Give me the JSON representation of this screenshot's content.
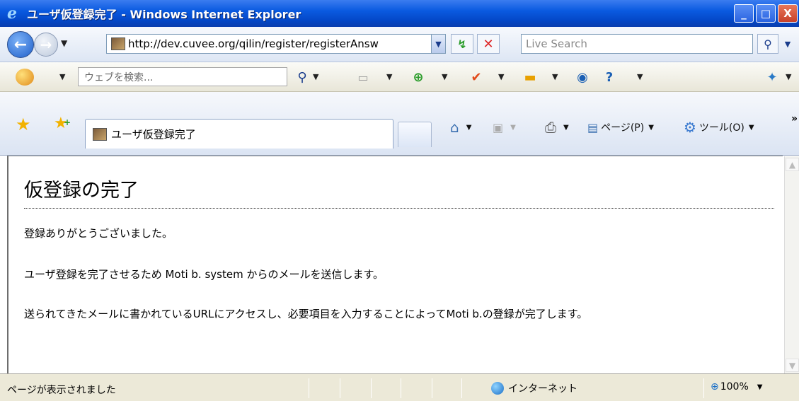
{
  "window": {
    "title": "ユーザ仮登録完了 - Windows Internet Explorer",
    "buttons": {
      "minimize": "_",
      "maximize": "□",
      "close": "X"
    }
  },
  "address_bar": {
    "url": "http://dev.cuvee.org/qilin/register/registerAnsw",
    "search_placeholder": "Live Search"
  },
  "search_toolbar": {
    "placeholder": "ウェブを検索..."
  },
  "tabs": [
    {
      "label": "ユーザ仮登録完了",
      "active": true
    }
  ],
  "command_bar": {
    "page_label": "ページ(P)",
    "tools_label": "ツール(O)"
  },
  "page": {
    "heading": "仮登録の完了",
    "paragraphs": [
      "登録ありがとうございました。",
      "ユーザ登録を完了させるため Moti b. system からのメールを送信します。",
      "送られてきたメールに書かれているURLにアクセスし、必要項目を入力することによってMoti b.の登録が完了します。"
    ]
  },
  "status_bar": {
    "status": "ページが表示されました",
    "zone": "インターネット",
    "zoom": "100%"
  },
  "icons": {
    "app": "ie-icon",
    "back": "back-arrow-icon",
    "forward": "forward-arrow-icon",
    "refresh": "refresh-icon",
    "stop": "stop-icon",
    "search": "magnifier-icon",
    "favorites": "star-icon",
    "home": "home-icon",
    "feed": "rss-icon",
    "print": "printer-icon",
    "tools": "gear-icon",
    "zone": "globe-icon",
    "zoom": "zoom-icon"
  },
  "colors": {
    "titlebar": "#0a5ae0",
    "close_button": "#c7412a",
    "status_bar": "#ece9d8"
  }
}
